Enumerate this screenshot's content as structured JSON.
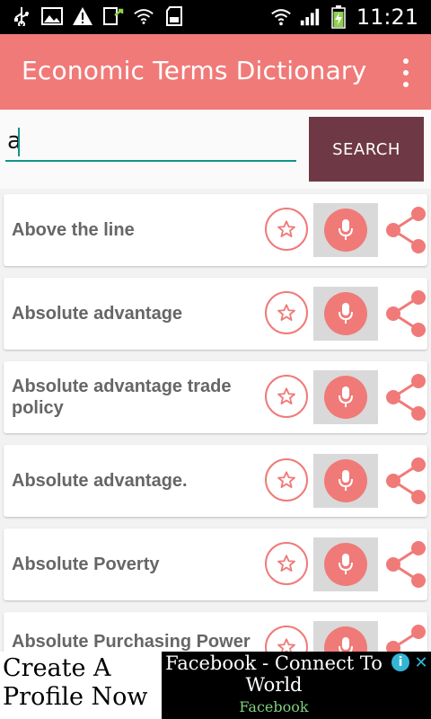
{
  "status_bar": {
    "time": "11:21",
    "left_icons": [
      "usb-icon",
      "image-icon",
      "warning-icon",
      "download-icon",
      "wifi-icon",
      "sdcard-icon"
    ],
    "right_icons": [
      "wifi-signal-icon",
      "cell-signal-icon",
      "battery-charging-icon"
    ]
  },
  "app_bar": {
    "title": "Economic Terms Dictionary",
    "overflow_icon": "more-vert-icon",
    "color": "#f07a78"
  },
  "search": {
    "value": "a",
    "button_label": "SEARCH",
    "accent": "#13938c",
    "button_color": "#6e3844"
  },
  "terms": [
    {
      "label": "Above the line"
    },
    {
      "label": "Absolute advantage"
    },
    {
      "label": "Absolute advantage trade policy"
    },
    {
      "label": "Absolute advantage."
    },
    {
      "label": "Absolute Poverty"
    },
    {
      "label": "Absolute Purchasing Power"
    }
  ],
  "row_icons": {
    "favorite": "star-icon",
    "speak": "microphone-icon",
    "share": "share-icon"
  },
  "ad": {
    "left_text": "Create A Profile Now",
    "title": "Facebook - Connect To World",
    "subtitle": "Facebook",
    "info_glyph": "i",
    "close_glyph": "✕"
  }
}
